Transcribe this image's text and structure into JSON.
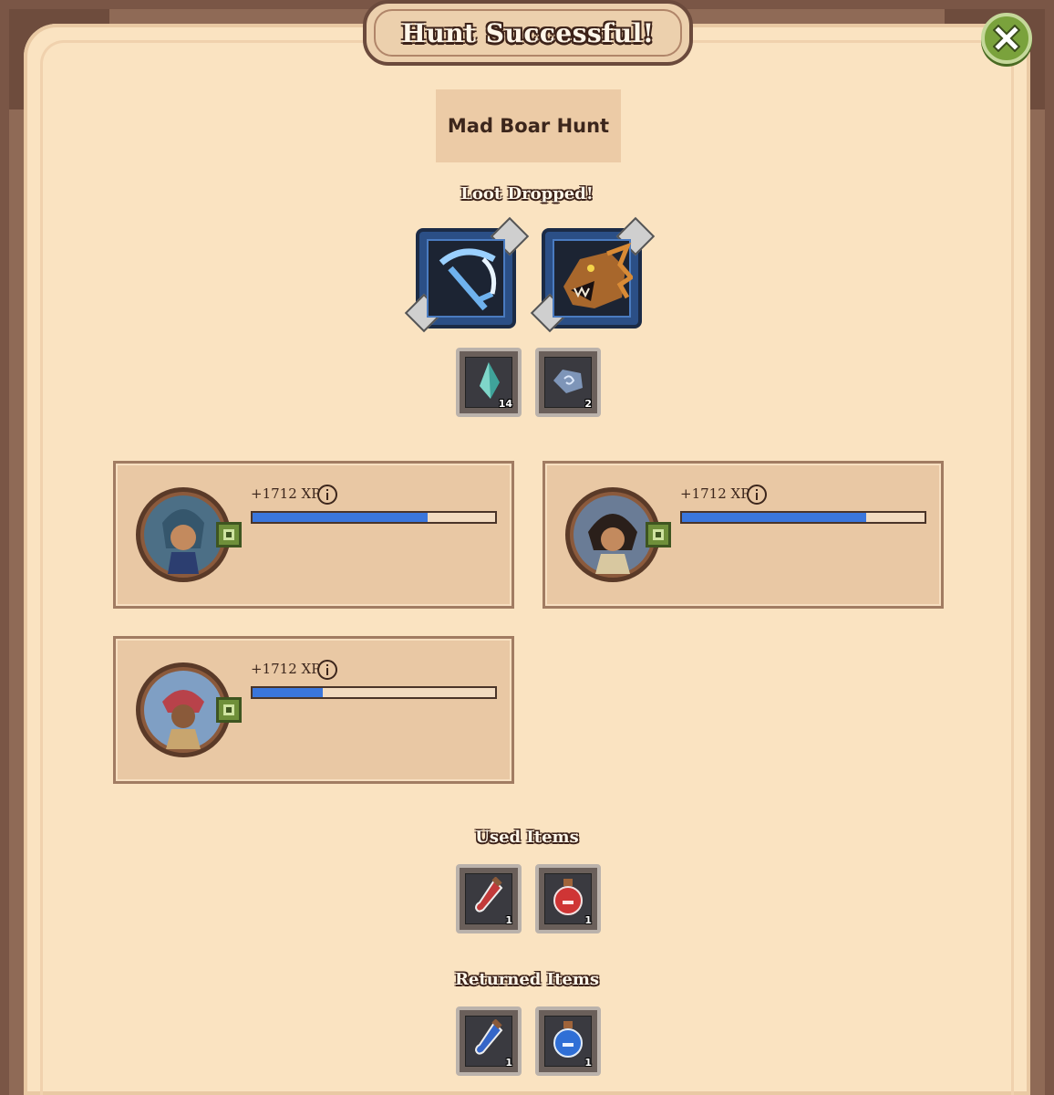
{
  "dialog": {
    "title": "Hunt Successful!"
  },
  "hunt": {
    "name": "Mad Boar Hunt"
  },
  "sections": {
    "loot": "Loot Dropped!",
    "used": "Used Items",
    "returned": "Returned Items"
  },
  "loot": {
    "rare": [
      {
        "name": "pickaxe-icon"
      },
      {
        "name": "dragon-head-icon"
      }
    ],
    "materials": [
      {
        "name": "crystal-shard-icon",
        "qty": "14"
      },
      {
        "name": "rune-stone-icon",
        "qty": "2"
      }
    ]
  },
  "heroes": [
    {
      "xp": "+1712 XP",
      "progress": 0.72
    },
    {
      "xp": "+1712 XP",
      "progress": 0.76
    },
    {
      "xp": "+1712 XP",
      "progress": 0.29
    }
  ],
  "used_items": [
    {
      "name": "red-vial-icon",
      "qty": "1"
    },
    {
      "name": "red-potion-icon",
      "qty": "1"
    }
  ],
  "returned_items": [
    {
      "name": "blue-vial-icon",
      "qty": "1"
    },
    {
      "name": "blue-potion-icon",
      "qty": "1"
    }
  ],
  "colors": {
    "xp_bar": "#3a76dc",
    "panel": "#fae3c1",
    "close_button": "#7aa23c"
  }
}
